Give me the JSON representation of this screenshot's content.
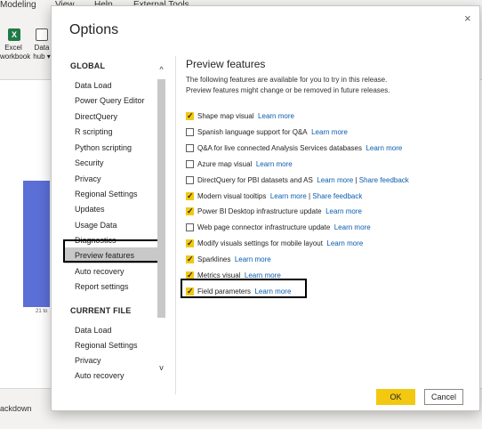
{
  "background": {
    "ribbon_tabs": [
      "Modeling",
      "View",
      "Help",
      "External Tools"
    ],
    "ribbon_buttons": [
      {
        "icon": "excel-icon",
        "label_line1": "Excel",
        "label_line2": "workbook"
      },
      {
        "icon": "data-hub-icon",
        "label_line1": "Data",
        "label_line2": "hub ▾"
      }
    ],
    "chart_axis_label": "21 to",
    "bottom_tab": "ackdown"
  },
  "dialog": {
    "title": "Options",
    "close_glyph": "×",
    "nav": {
      "global_heading": "GLOBAL",
      "global_items": [
        "Data Load",
        "Power Query Editor",
        "DirectQuery",
        "R scripting",
        "Python scripting",
        "Security",
        "Privacy",
        "Regional Settings",
        "Updates",
        "Usage Data",
        "Diagnostics",
        "Preview features",
        "Auto recovery",
        "Report settings"
      ],
      "selected": "Preview features",
      "current_file_heading": "CURRENT FILE",
      "current_file_items": [
        "Data Load",
        "Regional Settings",
        "Privacy",
        "Auto recovery"
      ],
      "scroll_up_glyph": "^",
      "scroll_down_glyph": "v"
    },
    "content": {
      "title": "Preview features",
      "description": "The following features are available for you to try in this release. Preview features might change or be removed in future releases.",
      "features": [
        {
          "label": "Shape map visual",
          "checked": true,
          "link": "Learn more",
          "link2": ""
        },
        {
          "label": "Spanish language support for Q&A",
          "checked": false,
          "link": "Learn more",
          "link2": ""
        },
        {
          "label": "Q&A for live connected Analysis Services databases",
          "checked": false,
          "link": "Learn more",
          "link2": ""
        },
        {
          "label": "Azure map visual",
          "checked": false,
          "link": "Learn more",
          "link2": ""
        },
        {
          "label": "DirectQuery for PBI datasets and AS",
          "checked": false,
          "link": "Learn more",
          "link2": "Share feedback"
        },
        {
          "label": "Modern visual tooltips",
          "checked": true,
          "link": "Learn more",
          "link2": "Share feedback"
        },
        {
          "label": "Power BI Desktop infrastructure update",
          "checked": true,
          "link": "Learn more",
          "link2": ""
        },
        {
          "label": "Web page connector infrastructure update",
          "checked": false,
          "link": "Learn more",
          "link2": ""
        },
        {
          "label": "Modify visuals settings for mobile layout",
          "checked": true,
          "link": "Learn more",
          "link2": ""
        },
        {
          "label": "Sparklines",
          "checked": true,
          "link": "Learn more",
          "link2": ""
        },
        {
          "label": "Metrics visual",
          "checked": true,
          "link": "Learn more",
          "link2": ""
        },
        {
          "label": "Field parameters",
          "checked": true,
          "link": "Learn more",
          "link2": ""
        }
      ],
      "separator": "|"
    },
    "ok_label": "OK",
    "cancel_label": "Cancel"
  },
  "colors": {
    "accent_yellow": "#f2c811",
    "link_blue": "#0b5cad",
    "selected_nav_bg": "#c8c8c8",
    "bar_blue": "#5b6fd6"
  }
}
